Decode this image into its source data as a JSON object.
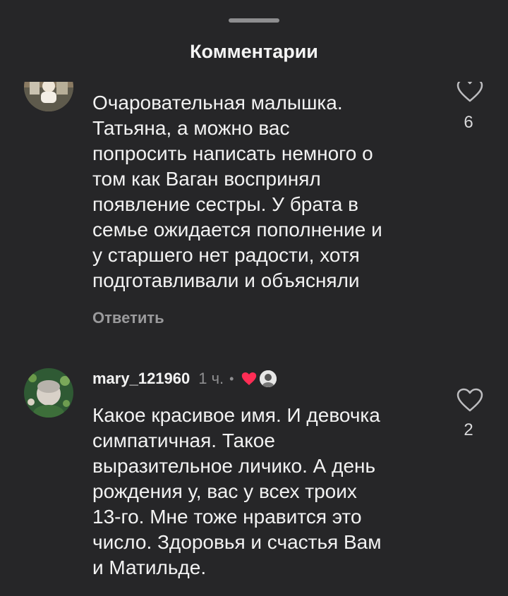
{
  "header": {
    "title": "Комментарии"
  },
  "comments": [
    {
      "text": "Очаровательная малышка.\nТатьяна, а можно вас\nпопросить написать немного о\nтом как Ваган воспринял\nпоявление сестры. У брата в\nсемье ожидается пополнение и\nу старшего нет радости, хотя\nподготавливали и объясняли",
      "reply_label": "Ответить",
      "likes": "6"
    },
    {
      "username": "mary_121960",
      "time": "1 ч.",
      "separator": "•",
      "text": "Какое красивое имя. И девочка\nсимпатичная. Такое\nвыразительное личико. А день\nрождения у, вас у всех троих\n13-го. Мне тоже нравится это\nчисло. Здоровья и счастья Вам\nи Матильде.",
      "likes": "2"
    }
  ],
  "colors": {
    "background": "#262628",
    "liked_heart": "#ff2d55",
    "muted_text": "#9a9a9c"
  }
}
